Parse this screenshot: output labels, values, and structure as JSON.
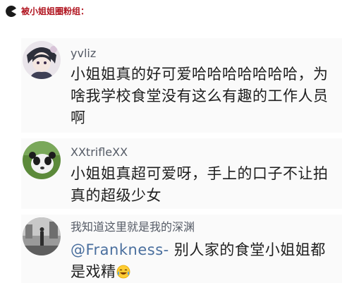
{
  "header": {
    "title": "被小姐姐圈粉组：",
    "icon": "pacman-icon",
    "title_color": "#b0121d"
  },
  "comments": [
    {
      "username": "yvliz",
      "text": "小姐姐真的好可爱哈哈哈哈哈哈哈，为啥我学校食堂没有这么有趣的工作人员啊",
      "avatar_icon": "anime-character-avatar"
    },
    {
      "username": "XXtrifleXX",
      "text": "小姐姐真超可爱呀，手上的口子不让拍真的超级少女",
      "avatar_icon": "panda-cat-avatar"
    },
    {
      "username": "我知道这里就是我的深渊",
      "mention": "@Frankness-",
      "text": " 别人家的食堂小姐姐都是戏精",
      "emoji_icon": "laughing-crying-emoji",
      "avatar_icon": "street-photo-avatar"
    }
  ],
  "colors": {
    "username": "#555b66",
    "text": "#1e1e1e",
    "mention": "#4a6f9e",
    "background": "#fafafa"
  }
}
